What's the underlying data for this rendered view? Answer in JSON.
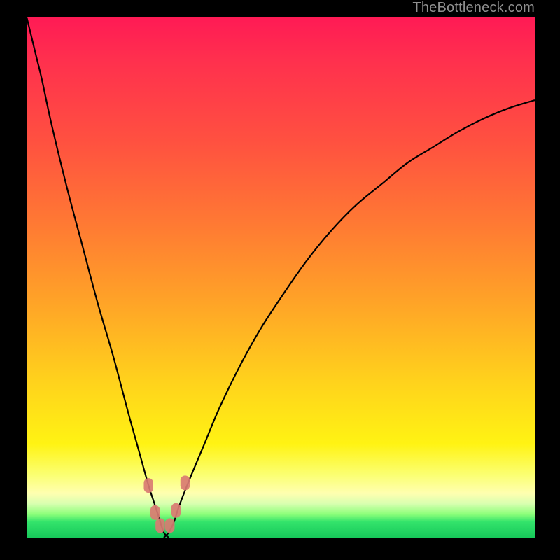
{
  "watermark": {
    "text": "TheBottleneck.com"
  },
  "chart_data": {
    "type": "line",
    "title": "",
    "xlabel": "",
    "ylabel": "",
    "xlim": [
      0,
      100
    ],
    "ylim": [
      0,
      100
    ],
    "grid": false,
    "legend": "none",
    "annotations": [],
    "plot_background": "vertical-gradient red→orange→yellow→pale→green",
    "frame_color": "#000000",
    "minimum_x_approx": 27,
    "series": [
      {
        "name": "left-branch",
        "color": "#000000",
        "x": [
          0,
          1,
          2,
          3,
          5,
          8,
          11,
          14,
          17,
          20,
          22,
          24,
          25,
          26,
          27,
          28
        ],
        "y": [
          100,
          96,
          92,
          88,
          79,
          67,
          56,
          45,
          35,
          24,
          17,
          10,
          7,
          4,
          1,
          0
        ]
      },
      {
        "name": "right-branch",
        "color": "#000000",
        "x": [
          27,
          28,
          29,
          30,
          32,
          35,
          38,
          42,
          46,
          50,
          55,
          60,
          65,
          70,
          75,
          80,
          85,
          90,
          95,
          100
        ],
        "y": [
          0,
          1,
          3,
          6,
          11,
          18,
          25,
          33,
          40,
          46,
          53,
          59,
          64,
          68,
          72,
          75,
          78,
          80.5,
          82.5,
          84
        ]
      }
    ],
    "markers": [
      {
        "name": "left-upper",
        "x": 24.0,
        "y": 10.0,
        "color": "#d97b72",
        "size": 10
      },
      {
        "name": "left-lower",
        "x": 25.3,
        "y": 4.8,
        "color": "#d97b72",
        "size": 10
      },
      {
        "name": "bottom-a",
        "x": 26.3,
        "y": 2.3,
        "color": "#d97b72",
        "size": 10
      },
      {
        "name": "bottom-b",
        "x": 28.2,
        "y": 2.3,
        "color": "#d97b72",
        "size": 10
      },
      {
        "name": "right-lower",
        "x": 29.4,
        "y": 5.2,
        "color": "#d97b72",
        "size": 10
      },
      {
        "name": "right-upper",
        "x": 31.2,
        "y": 10.5,
        "color": "#d97b72",
        "size": 10
      }
    ]
  }
}
